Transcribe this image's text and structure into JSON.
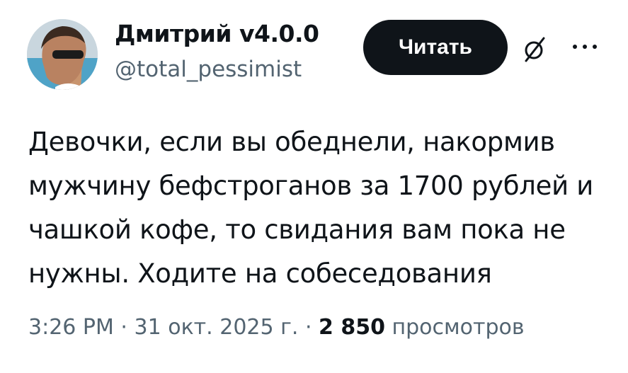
{
  "author": {
    "display_name": "Дмитрий v4.0.0",
    "handle": "@total_pessimist"
  },
  "actions": {
    "follow_label": "Читать",
    "grok_icon": "grok-slash-icon",
    "more_icon": "more-dots-icon"
  },
  "tweet": {
    "text": "Девочки, если вы обеднели, накормив\nмужчину бефстроганов за 1700 рублей и\nчашкой кофе, то свидания вам пока не\nнужны. Ходите на собеседования"
  },
  "meta": {
    "time": "3:26 PM",
    "separator1": " · ",
    "date": "31 окт. 2025 г.",
    "separator2": " · ",
    "views_count": "2 850",
    "views_label": " просмотров"
  },
  "colors": {
    "primary_text": "#0f1419",
    "secondary_text": "#536471",
    "button_bg": "#0f1419"
  }
}
